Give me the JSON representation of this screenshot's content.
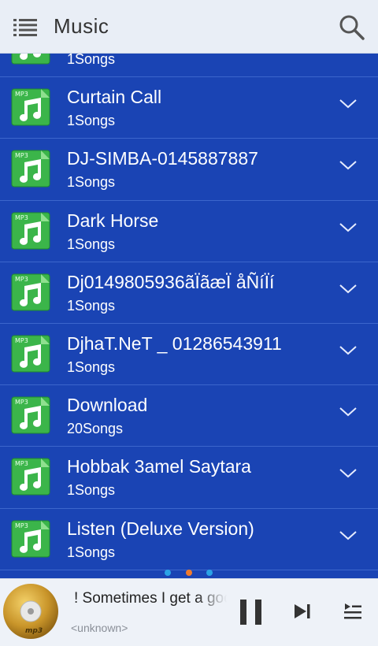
{
  "header": {
    "title": "Music"
  },
  "list": {
    "items": [
      {
        "title": "",
        "count": "1Songs"
      },
      {
        "title": "Curtain Call",
        "count": "1Songs"
      },
      {
        "title": "DJ-SIMBA-0145887887",
        "count": "1Songs"
      },
      {
        "title": "Dark Horse",
        "count": "1Songs"
      },
      {
        "title": "Dj0149805936ãÏãæÏ åÑíÏí",
        "count": "1Songs"
      },
      {
        "title": "DjhaT.NeT _ 01286543911",
        "count": "1Songs"
      },
      {
        "title": "Download",
        "count": "20Songs"
      },
      {
        "title": "Hobbak 3amel Saytara",
        "count": "1Songs"
      },
      {
        "title": "Listen (Deluxe Version)",
        "count": "1Songs"
      }
    ],
    "icon_badge": "MP3"
  },
  "now_playing": {
    "title": "! Sometimes I get a good feeling",
    "artist": "<unknown>",
    "art_label": "mp3"
  },
  "colors": {
    "list_bg": "#1a44b4",
    "header_bg": "#e9eef6",
    "icon_green": "#3bb54a",
    "dot_active": "#f07b2c",
    "dot_inactive": "#2aa3e6"
  }
}
